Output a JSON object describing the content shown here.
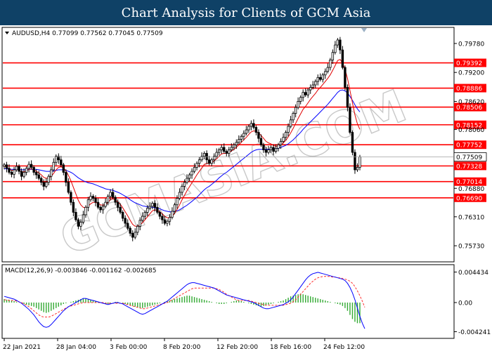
{
  "banner": {
    "title": "Chart Analysis for Clients of GCM Asia"
  },
  "watermark": "GCMASIA.COM",
  "chart_data": [
    {
      "type": "candlestick",
      "title": "AUDUSD,H4  0.77099 0.77562 0.77045 0.77509",
      "y_ticks": [
        "0.79780",
        "0.79200",
        "0.78620",
        "0.78060",
        "0.77500",
        "0.76880",
        "0.76310",
        "0.75730"
      ],
      "y_range": [
        0.7545,
        0.8006
      ],
      "current_price": {
        "value": 0.77509,
        "label": "0.77509"
      },
      "levels": [
        {
          "value": 0.79392,
          "label": "0.79392"
        },
        {
          "value": 0.78886,
          "label": "0.78886"
        },
        {
          "value": 0.78506,
          "label": "0.78506"
        },
        {
          "value": 0.78152,
          "label": "0.78152"
        },
        {
          "value": 0.77752,
          "label": "0.77752"
        },
        {
          "value": 0.77328,
          "label": "0.77328"
        },
        {
          "value": 0.77014,
          "label": "0.77014"
        },
        {
          "value": 0.7669,
          "label": "0.76690"
        }
      ],
      "x_labels": [
        "22 Jan 2021",
        "28 Jan 04:00",
        "3 Feb 00:00",
        "8 Feb 20:00",
        "12 Feb 20:00",
        "18 Feb 16:00",
        "24 Feb 12:00"
      ],
      "closes": [
        0.7735,
        0.7728,
        0.772,
        0.7716,
        0.7725,
        0.7732,
        0.7722,
        0.7712,
        0.772,
        0.7728,
        0.7736,
        0.773,
        0.772,
        0.7715,
        0.7708,
        0.77,
        0.7692,
        0.77,
        0.7712,
        0.7725,
        0.774,
        0.7752,
        0.7745,
        0.7735,
        0.772,
        0.77,
        0.768,
        0.766,
        0.764,
        0.7625,
        0.7612,
        0.762,
        0.7635,
        0.765,
        0.7665,
        0.7672,
        0.7668,
        0.766,
        0.765,
        0.7645,
        0.7652,
        0.766,
        0.7672,
        0.768,
        0.767,
        0.766,
        0.765,
        0.764,
        0.7628,
        0.7618,
        0.7608,
        0.7598,
        0.759,
        0.76,
        0.7612,
        0.7624,
        0.7632,
        0.764,
        0.7648,
        0.7652,
        0.7658,
        0.765,
        0.764,
        0.7632,
        0.7625,
        0.7618,
        0.7622,
        0.763,
        0.7642,
        0.7655,
        0.7668,
        0.768,
        0.7692,
        0.77,
        0.7708,
        0.7715,
        0.7722,
        0.773,
        0.7738,
        0.7745,
        0.7752,
        0.7758,
        0.7745,
        0.7738,
        0.7745,
        0.7752,
        0.776,
        0.7765,
        0.777,
        0.7762,
        0.7758,
        0.7765,
        0.777,
        0.7775,
        0.778,
        0.7786,
        0.7792,
        0.7798,
        0.7805,
        0.7812,
        0.7818,
        0.781,
        0.78,
        0.7788,
        0.7775,
        0.7765,
        0.776,
        0.7765,
        0.777,
        0.7762,
        0.7768,
        0.7775,
        0.7782,
        0.779,
        0.78,
        0.7812,
        0.7825,
        0.7838,
        0.785,
        0.7862,
        0.787,
        0.788,
        0.7875,
        0.7885,
        0.789,
        0.7895,
        0.7902,
        0.791,
        0.7906,
        0.7915,
        0.7922,
        0.793,
        0.7945,
        0.796,
        0.7975,
        0.7985,
        0.7965,
        0.793,
        0.789,
        0.785,
        0.78,
        0.776,
        0.7725,
        0.773,
        0.7751
      ],
      "ma_fast": [
        0.7733,
        0.773,
        0.7727,
        0.7724,
        0.7724,
        0.7726,
        0.7724,
        0.7721,
        0.7721,
        0.7723,
        0.7726,
        0.7727,
        0.7725,
        0.7722,
        0.7719,
        0.7715,
        0.771,
        0.7708,
        0.7709,
        0.7712,
        0.7718,
        0.7725,
        0.773,
        0.7731,
        0.7729,
        0.7723,
        0.7714,
        0.7703,
        0.769,
        0.7677,
        0.7664,
        0.7655,
        0.765,
        0.7649,
        0.7652,
        0.7657,
        0.766,
        0.766,
        0.7658,
        0.7655,
        0.7654,
        0.7656,
        0.766,
        0.7665,
        0.7667,
        0.7665,
        0.7661,
        0.7656,
        0.7649,
        0.7641,
        0.7633,
        0.7624,
        0.7616,
        0.7612,
        0.7612,
        0.7615,
        0.7619,
        0.7625,
        0.7631,
        0.7637,
        0.7643,
        0.7645,
        0.7644,
        0.7641,
        0.7637,
        0.7632,
        0.7629,
        0.7629,
        0.7632,
        0.7638,
        0.7646,
        0.7655,
        0.7665,
        0.7674,
        0.7683,
        0.7691,
        0.7699,
        0.7707,
        0.7715,
        0.7722,
        0.7729,
        0.7736,
        0.7738,
        0.7738,
        0.774,
        0.7743,
        0.7747,
        0.7752,
        0.7757,
        0.7758,
        0.7758,
        0.776,
        0.7763,
        0.7766,
        0.777,
        0.7775,
        0.778,
        0.7785,
        0.779,
        0.7796,
        0.7801,
        0.7803,
        0.7802,
        0.7799,
        0.7794,
        0.7788,
        0.7782,
        0.7779,
        0.7777,
        0.7774,
        0.7772,
        0.7773,
        0.7775,
        0.7779,
        0.7784,
        0.7791,
        0.7799,
        0.7808,
        0.7818,
        0.7828,
        0.7837,
        0.7846,
        0.7852,
        0.7859,
        0.7866,
        0.7872,
        0.7878,
        0.7885,
        0.789,
        0.7896,
        0.7902,
        0.7908,
        0.7915,
        0.7924,
        0.7934,
        0.7944,
        0.7946,
        0.7939,
        0.7926,
        0.7908,
        0.7884,
        0.7859,
        0.7835,
        0.7817,
        0.7806
      ],
      "ma_slow": [
        0.7727,
        0.7727,
        0.7726,
        0.7726,
        0.7726,
        0.7726,
        0.7726,
        0.7725,
        0.7725,
        0.7725,
        0.7726,
        0.7726,
        0.7726,
        0.7726,
        0.7725,
        0.7724,
        0.7723,
        0.7722,
        0.7722,
        0.7722,
        0.7723,
        0.7724,
        0.7725,
        0.7725,
        0.7725,
        0.7724,
        0.7722,
        0.772,
        0.7717,
        0.7713,
        0.7709,
        0.7706,
        0.7703,
        0.7701,
        0.7699,
        0.7698,
        0.7697,
        0.7695,
        0.7693,
        0.7691,
        0.7689,
        0.7687,
        0.7686,
        0.7685,
        0.7684,
        0.7682,
        0.768,
        0.7678,
        0.7675,
        0.7672,
        0.7669,
        0.7665,
        0.7662,
        0.7659,
        0.7657,
        0.7655,
        0.7653,
        0.7652,
        0.7651,
        0.765,
        0.765,
        0.7649,
        0.7648,
        0.7647,
        0.7645,
        0.7643,
        0.7642,
        0.7641,
        0.7641,
        0.7642,
        0.7643,
        0.7645,
        0.7648,
        0.7651,
        0.7654,
        0.7658,
        0.7662,
        0.7666,
        0.767,
        0.7675,
        0.768,
        0.7685,
        0.7689,
        0.7692,
        0.7696,
        0.77,
        0.7704,
        0.7709,
        0.7713,
        0.7717,
        0.772,
        0.7724,
        0.7728,
        0.7732,
        0.7736,
        0.774,
        0.7744,
        0.7748,
        0.7752,
        0.7756,
        0.776,
        0.7763,
        0.7765,
        0.7766,
        0.7766,
        0.7766,
        0.7766,
        0.7766,
        0.7767,
        0.7767,
        0.7767,
        0.7768,
        0.777,
        0.7772,
        0.7774,
        0.7777,
        0.7781,
        0.7785,
        0.779,
        0.7795,
        0.78,
        0.7806,
        0.7811,
        0.7816,
        0.7821,
        0.7826,
        0.7831,
        0.7836,
        0.7841,
        0.7846,
        0.7851,
        0.7856,
        0.7862,
        0.7868,
        0.7874,
        0.788,
        0.7884,
        0.7885,
        0.7883,
        0.7879,
        0.7872,
        0.7864,
        0.7855,
        0.7847,
        0.7841
      ]
    },
    {
      "type": "macd",
      "title": "MACD(12,26,9) -0.003846 -0.001162 -0.002685",
      "y_ticks": [
        "0.004434",
        "0.00",
        "-0.004241"
      ],
      "y_range": [
        -0.0048,
        0.005
      ],
      "histogram": [
        0.0005,
        0.0004,
        0.0004,
        0.0003,
        0.0002,
        0.0001,
        0.0,
        -0.0001,
        -0.0002,
        -0.0003,
        -0.0004,
        -0.0005,
        -0.0006,
        -0.0008,
        -0.001,
        -0.0012,
        -0.0014,
        -0.0015,
        -0.0014,
        -0.0012,
        -0.001,
        -0.0008,
        -0.0006,
        -0.0004,
        -0.0002,
        -0.0001,
        0.0,
        0.0001,
        0.0002,
        0.0003,
        0.0004,
        0.0005,
        0.0006,
        0.0006,
        0.0005,
        0.0004,
        0.0003,
        0.0002,
        0.0001,
        0.0,
        -0.0001,
        -0.0001,
        -0.0002,
        -0.0001,
        0.0,
        0.0001,
        0.0001,
        0.0,
        -0.0001,
        -0.0002,
        -0.0003,
        -0.0004,
        -0.0005,
        -0.0006,
        -0.0007,
        -0.0008,
        -0.0008,
        -0.0007,
        -0.0006,
        -0.0005,
        -0.0004,
        -0.0003,
        -0.0002,
        -0.0001,
        0.0,
        0.0001,
        0.0002,
        0.0003,
        0.0004,
        0.0005,
        0.0006,
        0.0007,
        0.0008,
        0.0009,
        0.001,
        0.001,
        0.0009,
        0.0008,
        0.0007,
        0.0006,
        0.0005,
        0.0004,
        0.0003,
        0.0002,
        0.0001,
        0.0,
        -0.0001,
        -0.0002,
        -0.0002,
        -0.0002,
        -0.0001,
        0.0,
        0.0001,
        0.0002,
        0.0003,
        0.0003,
        0.0002,
        0.0001,
        0.0,
        -0.0001,
        -0.0002,
        -0.0003,
        -0.0004,
        -0.0005,
        -0.0006,
        -0.0005,
        -0.0004,
        -0.0003,
        -0.0002,
        -0.0001,
        0.0,
        0.0001,
        0.0002,
        0.0003,
        0.0005,
        0.0007,
        0.0009,
        0.001,
        0.0011,
        0.0012,
        0.0013,
        0.0012,
        0.0011,
        0.001,
        0.0009,
        0.0008,
        0.0007,
        0.0006,
        0.0005,
        0.0004,
        0.0003,
        0.0002,
        0.0001,
        0.0,
        -0.0001,
        -0.0002,
        -0.0003,
        -0.0005,
        -0.0008,
        -0.0012,
        -0.0018,
        -0.0024,
        -0.0028,
        -0.003,
        -0.003
      ],
      "macd": [
        0.0009,
        0.0008,
        0.0007,
        0.0006,
        0.0005,
        0.0003,
        0.0001,
        -0.0001,
        -0.0004,
        -0.0007,
        -0.001,
        -0.0014,
        -0.0018,
        -0.0023,
        -0.0028,
        -0.0032,
        -0.0035,
        -0.0036,
        -0.0035,
        -0.0032,
        -0.0028,
        -0.0024,
        -0.002,
        -0.0016,
        -0.0012,
        -0.0009,
        -0.0006,
        -0.0004,
        -0.0002,
        0.0,
        0.0002,
        0.0004,
        0.0006,
        0.0006,
        0.0005,
        0.0004,
        0.0003,
        0.0002,
        0.0001,
        0.0,
        -0.0001,
        -0.0002,
        -0.0003,
        -0.0002,
        -0.0001,
        0.0,
        0.0,
        -0.0001,
        -0.0002,
        -0.0004,
        -0.0006,
        -0.0008,
        -0.001,
        -0.0012,
        -0.0014,
        -0.0016,
        -0.0017,
        -0.0016,
        -0.0014,
        -0.0012,
        -0.001,
        -0.0008,
        -0.0006,
        -0.0004,
        -0.0002,
        0.0,
        0.0002,
        0.0005,
        0.0008,
        0.0011,
        0.0014,
        0.0017,
        0.002,
        0.0023,
        0.0026,
        0.0028,
        0.0029,
        0.0029,
        0.0028,
        0.0027,
        0.0026,
        0.0025,
        0.0024,
        0.0023,
        0.0022,
        0.0021,
        0.0019,
        0.0017,
        0.0015,
        0.0013,
        0.0011,
        0.001,
        0.0009,
        0.0008,
        0.0007,
        0.0006,
        0.0005,
        0.0004,
        0.0003,
        0.0002,
        0.0001,
        0.0,
        -0.0002,
        -0.0004,
        -0.0006,
        -0.0008,
        -0.0009,
        -0.0009,
        -0.0008,
        -0.0007,
        -0.0006,
        -0.0005,
        -0.0004,
        -0.0003,
        -0.0001,
        0.0001,
        0.0004,
        0.0008,
        0.0013,
        0.0018,
        0.0023,
        0.0028,
        0.0033,
        0.0037,
        0.004,
        0.0042,
        0.0043,
        0.0044,
        0.0043,
        0.0042,
        0.0041,
        0.004,
        0.0039,
        0.0038,
        0.0037,
        0.0036,
        0.0035,
        0.0034,
        0.0032,
        0.0028,
        0.0022,
        0.0014,
        0.0004,
        -0.0008,
        -0.002,
        -0.003,
        -0.0038
      ],
      "signal": [
        0.0004,
        0.0004,
        0.0003,
        0.0003,
        0.0003,
        0.0002,
        0.0001,
        0.0,
        -0.0002,
        -0.0004,
        -0.0006,
        -0.0009,
        -0.0012,
        -0.0015,
        -0.0018,
        -0.002,
        -0.0021,
        -0.0021,
        -0.0021,
        -0.002,
        -0.0018,
        -0.0016,
        -0.0014,
        -0.0012,
        -0.001,
        -0.0008,
        -0.0006,
        -0.0005,
        -0.0004,
        -0.0003,
        -0.0002,
        -0.0001,
        0.0,
        0.0,
        0.0,
        0.0,
        0.0,
        0.0,
        0.0,
        0.0,
        0.0,
        -0.0001,
        -0.0001,
        -0.0001,
        -0.0001,
        -0.0001,
        -0.0001,
        -0.0001,
        -0.0001,
        -0.0002,
        -0.0003,
        -0.0004,
        -0.0005,
        -0.0006,
        -0.0007,
        -0.0008,
        -0.0009,
        -0.0009,
        -0.0008,
        -0.0007,
        -0.0006,
        -0.0005,
        -0.0004,
        -0.0003,
        -0.0002,
        -0.0001,
        0.0,
        0.0002,
        0.0004,
        0.0006,
        0.0008,
        0.001,
        0.0012,
        0.0014,
        0.0016,
        0.0018,
        0.002,
        0.0021,
        0.0021,
        0.0021,
        0.0021,
        0.0021,
        0.0021,
        0.0021,
        0.0021,
        0.0021,
        0.002,
        0.0019,
        0.0017,
        0.0015,
        0.0012,
        0.001,
        0.0008,
        0.0006,
        0.0004,
        0.0003,
        0.0003,
        0.0003,
        0.0003,
        0.0003,
        0.0002,
        0.0001,
        0.0,
        -0.0001,
        -0.0002,
        -0.0003,
        -0.0004,
        -0.0004,
        -0.0004,
        -0.0004,
        -0.0004,
        -0.0004,
        -0.0004,
        -0.0004,
        -0.0003,
        -0.0002,
        -0.0001,
        0.0001,
        0.0004,
        0.0008,
        0.0012,
        0.0016,
        0.002,
        0.0024,
        0.0028,
        0.0031,
        0.0034,
        0.0036,
        0.0037,
        0.0038,
        0.0038,
        0.0038,
        0.0038,
        0.0037,
        0.0037,
        0.0036,
        0.0036,
        0.0035,
        0.0034,
        0.0033,
        0.0031,
        0.0028,
        0.0023,
        0.0017,
        0.001,
        0.0002,
        -0.0007
      ]
    }
  ]
}
